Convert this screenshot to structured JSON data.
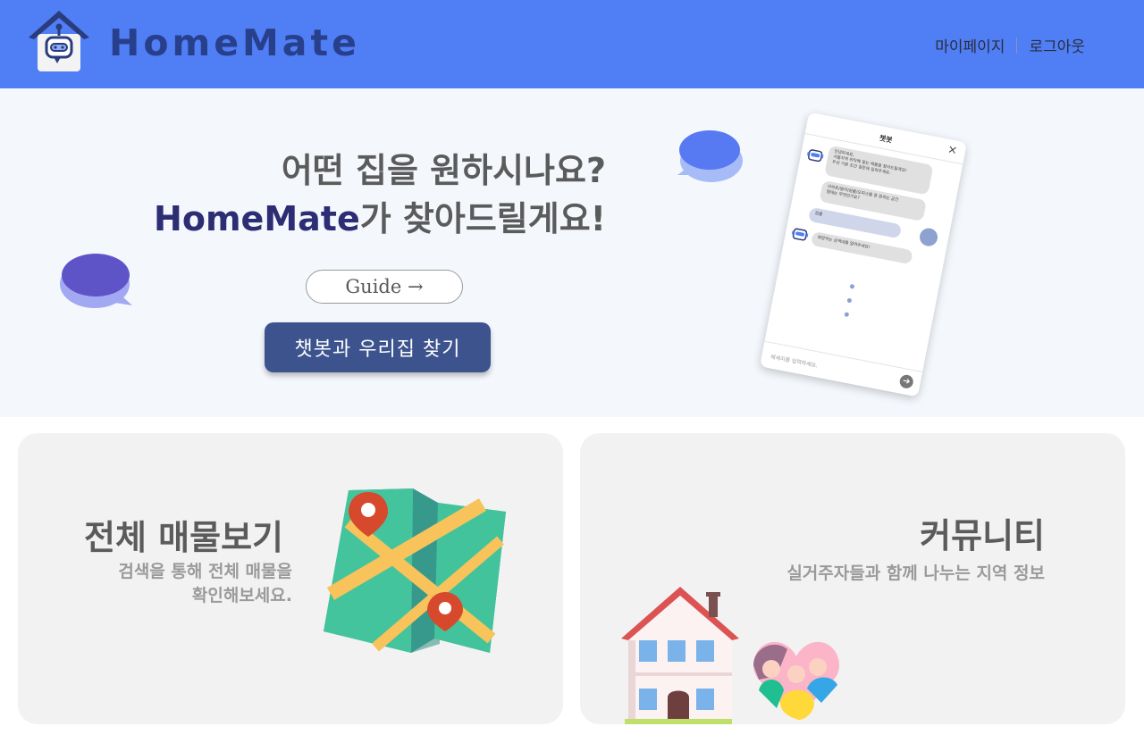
{
  "header": {
    "brand": "HomeMate",
    "nav": {
      "mypage": "마이페이지",
      "logout": "로그아웃"
    }
  },
  "hero": {
    "line1": "어떤 집을 원하시나요?",
    "line2_brand": "HomeMate",
    "line2_rest": "가 찾아드릴게요!",
    "guide_label": "Guide →",
    "chat_label": "챗봇과 우리집 찾기"
  },
  "chat_preview": {
    "title": "챗봇",
    "close": "×",
    "msg1": "안녕하세요,\n서울지역 위탁해 찾는 매물을 찾아드릴게요!\n우선 기본 조건 질문에 입력주세요.",
    "msg2": "아파트/빌라/원룸/오피스텔 중 원하는 공간\n형태는 무엇인가요?",
    "msg3": "원룸",
    "msg4": "희망하는 금액대를 알려주세요!",
    "placeholder": "메세지를 입력하세요."
  },
  "cards": {
    "listings": {
      "title": "전체 매물보기",
      "subtitle": "검색을 통해 전체 매물을\n확인해보세요."
    },
    "community": {
      "title": "커뮤니티",
      "subtitle": "실거주자들과 함께 나누는 지역 정보"
    }
  },
  "colors": {
    "header_bg": "#4f7ef5",
    "brand_text": "#28408c",
    "hero_bg": "#f4f8fd",
    "chat_button": "#3c538d",
    "card_bg": "#f2f2f2"
  },
  "icons": {
    "logo": "robot-house-icon",
    "bubble_left": "speech-bubble-icon",
    "bubble_right": "speech-bubble-icon",
    "map": "map-with-pins-icon",
    "house": "house-icon",
    "community": "heart-people-icon"
  }
}
